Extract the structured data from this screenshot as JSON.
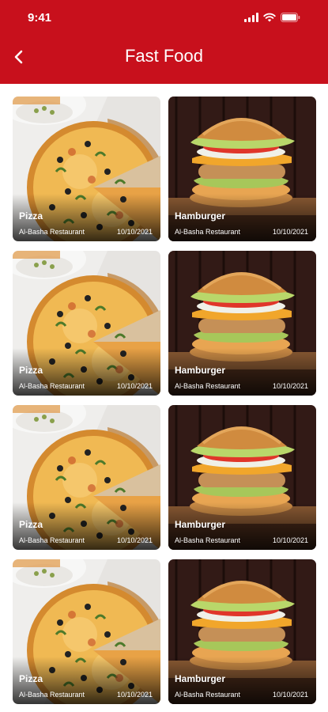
{
  "status_bar": {
    "time": "9:41"
  },
  "header": {
    "title": "Fast Food"
  },
  "colors": {
    "header_bg": "#c8101c"
  },
  "items": [
    {
      "name": "Pizza",
      "restaurant": "Al-Basha Restaurant",
      "date": "10/10/2021",
      "image": "pizza"
    },
    {
      "name": "Hamburger",
      "restaurant": "Al-Basha Restaurant",
      "date": "10/10/2021",
      "image": "hamburger"
    },
    {
      "name": "Pizza",
      "restaurant": "Al-Basha Restaurant",
      "date": "10/10/2021",
      "image": "pizza"
    },
    {
      "name": "Hamburger",
      "restaurant": "Al-Basha Restaurant",
      "date": "10/10/2021",
      "image": "hamburger"
    },
    {
      "name": "Pizza",
      "restaurant": "Al-Basha Restaurant",
      "date": "10/10/2021",
      "image": "pizza"
    },
    {
      "name": "Hamburger",
      "restaurant": "Al-Basha Restaurant",
      "date": "10/10/2021",
      "image": "hamburger"
    },
    {
      "name": "Pizza",
      "restaurant": "Al-Basha Restaurant",
      "date": "10/10/2021",
      "image": "pizza"
    },
    {
      "name": "Hamburger",
      "restaurant": "Al-Basha Restaurant",
      "date": "10/10/2021",
      "image": "hamburger"
    }
  ]
}
